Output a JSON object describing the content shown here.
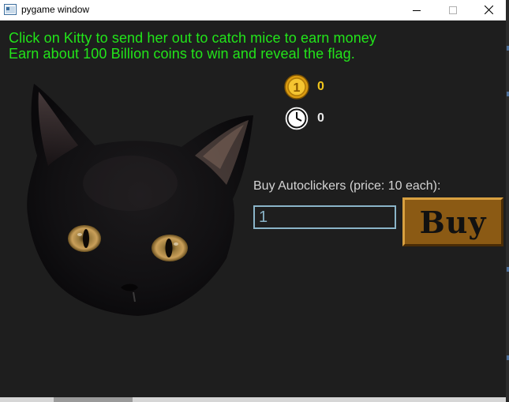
{
  "window": {
    "title": "pygame window",
    "controls": {
      "minimize_icon": "minimize-icon",
      "maximize_icon": "maximize-icon",
      "close_icon": "close-icon"
    }
  },
  "game": {
    "instructions": {
      "line1": "Click on Kitty to send her out to catch mice to earn money",
      "line2": "Earn about 100 Billion coins to win and reveal the flag."
    },
    "kitty": {
      "icon": "black-cat-face"
    },
    "stats": {
      "coins": "0",
      "coins_icon": "coin-icon",
      "coins_color": "#f2c61c",
      "timer": "0",
      "timer_icon": "clock-icon"
    },
    "shop": {
      "label": "Buy Autoclickers (price: 10 each):",
      "quantity_value": "1",
      "buy_label": "Buy",
      "buy_color": "#8b5a14"
    },
    "colors": {
      "background": "#1e1e1e",
      "instruction_text": "#22e51a",
      "input_border": "#8ab4c8"
    }
  }
}
